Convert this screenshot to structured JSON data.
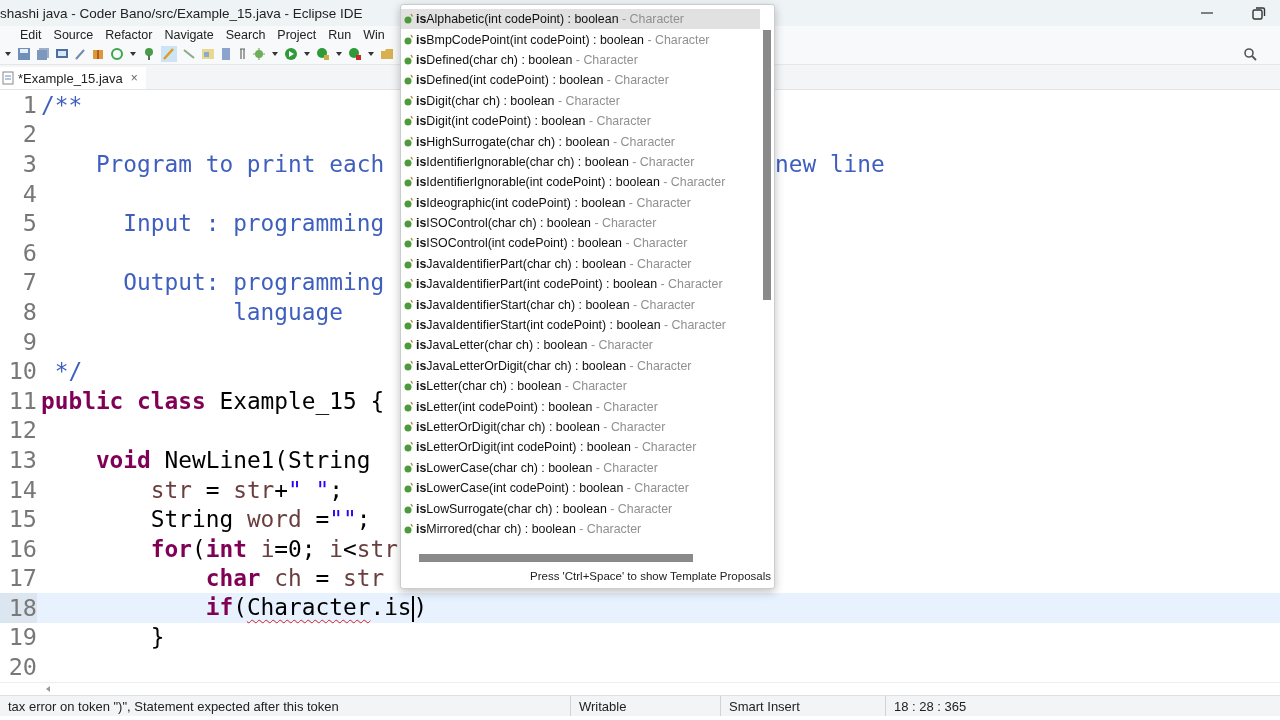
{
  "window": {
    "title": "shashi java - Coder Bano/src/Example_15.java - Eclipse IDE"
  },
  "menu": [
    "Edit",
    "Source",
    "Refactor",
    "Navigate",
    "Search",
    "Project",
    "Run",
    "Win"
  ],
  "tab": {
    "label": "*Example_15.java",
    "close": "×",
    "selected": true
  },
  "editor": {
    "lines": [
      {
        "number": "1",
        "current": false,
        "tokens": [
          {
            "text": "/**",
            "kind": "comment"
          }
        ]
      },
      {
        "number": "2",
        "current": false
      },
      {
        "number": "3",
        "current": false,
        "tokens": [
          {
            "text": "    Program to print each",
            "kind": "comment"
          }
        ],
        "right": [
          {
            "text": "new line",
            "kind": "comment"
          }
        ]
      },
      {
        "number": "4",
        "current": false
      },
      {
        "number": "5",
        "current": false,
        "tokens": [
          {
            "text": "      Input : programming",
            "kind": "comment"
          }
        ]
      },
      {
        "number": "6",
        "current": false
      },
      {
        "number": "7",
        "current": false,
        "tokens": [
          {
            "text": "      Output: programming",
            "kind": "comment"
          }
        ]
      },
      {
        "number": "8",
        "current": false,
        "tokens": [
          {
            "text": "              language",
            "kind": "comment"
          }
        ]
      },
      {
        "number": "9",
        "current": false
      },
      {
        "number": "10",
        "current": false,
        "tokens": [
          {
            "text": " */",
            "kind": "comment"
          }
        ]
      },
      {
        "number": "11",
        "current": false,
        "tokens": [
          {
            "text": "public class",
            "kind": "keyword"
          },
          {
            "text": " Example_15 {",
            "kind": "plain"
          }
        ]
      },
      {
        "number": "12",
        "current": false
      },
      {
        "number": "13",
        "current": false,
        "tokens": [
          {
            "text": "    void",
            "kind": "keyword"
          },
          {
            "text": " NewLine1(String",
            "kind": "plain"
          }
        ]
      },
      {
        "number": "14",
        "current": false,
        "tokens": [
          {
            "text": "        str",
            "kind": "variable"
          },
          {
            "text": " = ",
            "kind": "plain"
          },
          {
            "text": "str",
            "kind": "variable"
          },
          {
            "text": "+",
            "kind": "plain"
          },
          {
            "text": "\" \"",
            "kind": "string"
          },
          {
            "text": ";",
            "kind": "plain"
          }
        ]
      },
      {
        "number": "15",
        "current": false,
        "tokens": [
          {
            "text": "        String ",
            "kind": "plain"
          },
          {
            "text": "word",
            "kind": "variable"
          },
          {
            "text": " =",
            "kind": "plain"
          },
          {
            "text": "\"\"",
            "kind": "string"
          },
          {
            "text": ";",
            "kind": "plain"
          }
        ]
      },
      {
        "number": "16",
        "current": false,
        "tokens": [
          {
            "text": "        for",
            "kind": "keyword"
          },
          {
            "text": "(",
            "kind": "plain"
          },
          {
            "text": "int ",
            "kind": "keyword"
          },
          {
            "text": "i",
            "kind": "variable"
          },
          {
            "text": "=0; ",
            "kind": "plain"
          },
          {
            "text": "i",
            "kind": "variable"
          },
          {
            "text": "<",
            "kind": "plain"
          },
          {
            "text": "str",
            "kind": "variable"
          }
        ]
      },
      {
        "number": "17",
        "current": false,
        "tokens": [
          {
            "text": "            char ",
            "kind": "keyword"
          },
          {
            "text": "ch",
            "kind": "variable"
          },
          {
            "text": " = ",
            "kind": "plain"
          },
          {
            "text": "str",
            "kind": "variable"
          }
        ]
      },
      {
        "number": "18",
        "current": true,
        "tokens": [
          {
            "text": "            if",
            "kind": "keyword"
          },
          {
            "text": "(",
            "kind": "plain"
          },
          {
            "text": "Character",
            "kind": "error"
          },
          {
            "text": ".is",
            "kind": "plain"
          },
          {
            "kind": "caret"
          },
          {
            "text": ")",
            "kind": "plain"
          }
        ]
      },
      {
        "number": "19",
        "current": false,
        "tokens": [
          {
            "text": "        }",
            "kind": "plain"
          }
        ]
      },
      {
        "number": "20",
        "current": false
      }
    ]
  },
  "completion": {
    "items": [
      {
        "label": "**is**Alphabetic(int codePoint) : boolean",
        "owner": " - Character",
        "selected": true
      },
      {
        "label": "**is**BmpCodePoint(int codePoint) : boolean",
        "owner": " - Character",
        "selected": false
      },
      {
        "label": "**is**Defined(char ch) : boolean",
        "owner": " - Character",
        "selected": false
      },
      {
        "label": "**is**Defined(int codePoint) : boolean",
        "owner": " - Character",
        "selected": false
      },
      {
        "label": "**is**Digit(char ch) : boolean",
        "owner": " - Character",
        "selected": false
      },
      {
        "label": "**is**Digit(int codePoint) : boolean",
        "owner": " - Character",
        "selected": false
      },
      {
        "label": "**is**HighSurrogate(char ch) : boolean",
        "owner": " - Character",
        "selected": false
      },
      {
        "label": "**is**IdentifierIgnorable(char ch) : boolean",
        "owner": " - Character",
        "selected": false
      },
      {
        "label": "**is**IdentifierIgnorable(int codePoint) : boolean",
        "owner": " - Character",
        "selected": false
      },
      {
        "label": "**is**Ideographic(int codePoint) : boolean",
        "owner": " - Character",
        "selected": false
      },
      {
        "label": "**is**ISOControl(char ch) : boolean",
        "owner": " - Character",
        "selected": false
      },
      {
        "label": "**is**ISOControl(int codePoint) : boolean",
        "owner": " - Character",
        "selected": false
      },
      {
        "label": "**is**JavaIdentifierPart(char ch) : boolean",
        "owner": " - Character",
        "selected": false
      },
      {
        "label": "**is**JavaIdentifierPart(int codePoint) : boolean",
        "owner": " - Character",
        "selected": false
      },
      {
        "label": "**is**JavaIdentifierStart(char ch) : boolean",
        "owner": " - Character",
        "selected": false
      },
      {
        "label": "**is**JavaIdentifierStart(int codePoint) : boolean",
        "owner": " - Character",
        "selected": false
      },
      {
        "label": "**is**JavaLetter(char ch) : boolean",
        "owner": " - Character",
        "selected": false
      },
      {
        "label": "**is**JavaLetterOrDigit(char ch) : boolean",
        "owner": " - Character",
        "selected": false
      },
      {
        "label": "**is**Letter(char ch) : boolean",
        "owner": " - Character",
        "selected": false
      },
      {
        "label": "**is**Letter(int codePoint) : boolean",
        "owner": " - Character",
        "selected": false
      },
      {
        "label": "**is**LetterOrDigit(char ch) : boolean",
        "owner": " - Character",
        "selected": false
      },
      {
        "label": "**is**LetterOrDigit(int codePoint) : boolean",
        "owner": " - Character",
        "selected": false
      },
      {
        "label": "**is**LowerCase(char ch) : boolean",
        "owner": " - Character",
        "selected": false
      },
      {
        "label": "**is**LowerCase(int codePoint) : boolean",
        "owner": " - Character",
        "selected": false
      },
      {
        "label": "**is**LowSurrogate(char ch) : boolean",
        "owner": " - Character",
        "selected": false
      },
      {
        "label": "**is**Mirrored(char ch) : boolean",
        "owner": " - Character",
        "selected": false
      }
    ],
    "hint": "Press 'Ctrl+Space' to show Template Proposals"
  },
  "status_bar": {
    "message": "tax error on token \")\", Statement expected after this token",
    "mode": "Writable",
    "insert": "Smart Insert",
    "position": "18 : 28 : 365"
  }
}
